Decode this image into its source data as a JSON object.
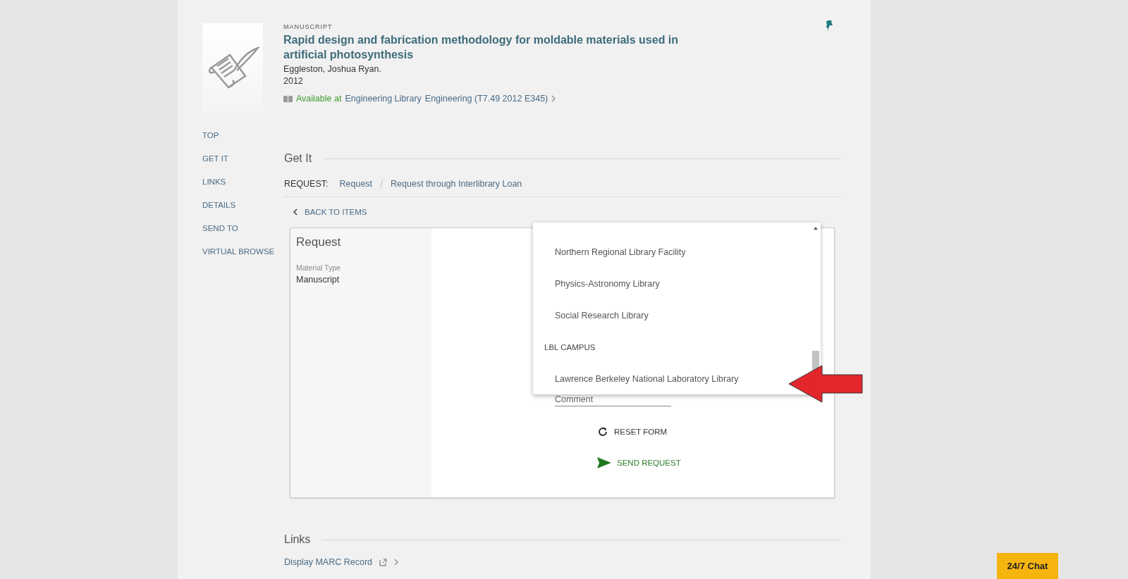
{
  "record": {
    "type_label": "MANUSCRIPT",
    "title": "Rapid design and fabrication methodology for moldable materials used in artificial photosynthesis",
    "author": "Eggleston, Joshua Ryan.",
    "year": "2012",
    "availability": {
      "status": "Available at",
      "location": "Engineering Library",
      "collection": "Engineering",
      "call_number": "(T7.49 2012 E345)"
    }
  },
  "sidebar": {
    "items": [
      "TOP",
      "GET IT",
      "LINKS",
      "DETAILS",
      "SEND TO",
      "VIRTUAL BROWSE"
    ]
  },
  "get_it": {
    "heading": "Get It",
    "request_label": "REQUEST:",
    "request_options": [
      "Request",
      "Request through Interlibrary Loan"
    ],
    "back_link": "BACK TO ITEMS",
    "form": {
      "title": "Request",
      "material_type_label": "Material Type",
      "material_type": "Manuscript",
      "comment_placeholder": "Comment",
      "reset_button": "RESET FORM",
      "send_button": "SEND REQUEST"
    },
    "dropdown": {
      "items": [
        {
          "kind": "option",
          "label": "Northern Regional Library Facility"
        },
        {
          "kind": "option",
          "label": "Physics-Astronomy Library"
        },
        {
          "kind": "option",
          "label": "Social Research Library"
        },
        {
          "kind": "group",
          "label": "LBL CAMPUS"
        },
        {
          "kind": "option",
          "label": "Lawrence Berkeley National Laboratory Library"
        }
      ]
    }
  },
  "links": {
    "heading": "Links",
    "items": [
      "Display MARC Record"
    ]
  },
  "chat_button": "24/7 Chat"
}
